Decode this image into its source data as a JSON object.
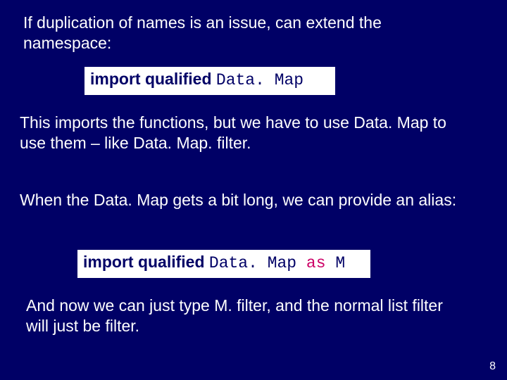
{
  "para1": "If duplication of names is an issue, can extend the namespace:",
  "code1": {
    "import": "import qualified ",
    "module": "Data. Map"
  },
  "para2": "This imports the functions, but we have to use Data. Map to use them – like Data. Map. filter.",
  "para3": "When the Data. Map gets a bit long, we can provide an alias:",
  "code2": {
    "import": "import qualified ",
    "module": "Data. Map ",
    "as": "as ",
    "alias": "M"
  },
  "para4": "And now we can just type M. filter, and the normal list filter will just be filter.",
  "pagenum": "8"
}
